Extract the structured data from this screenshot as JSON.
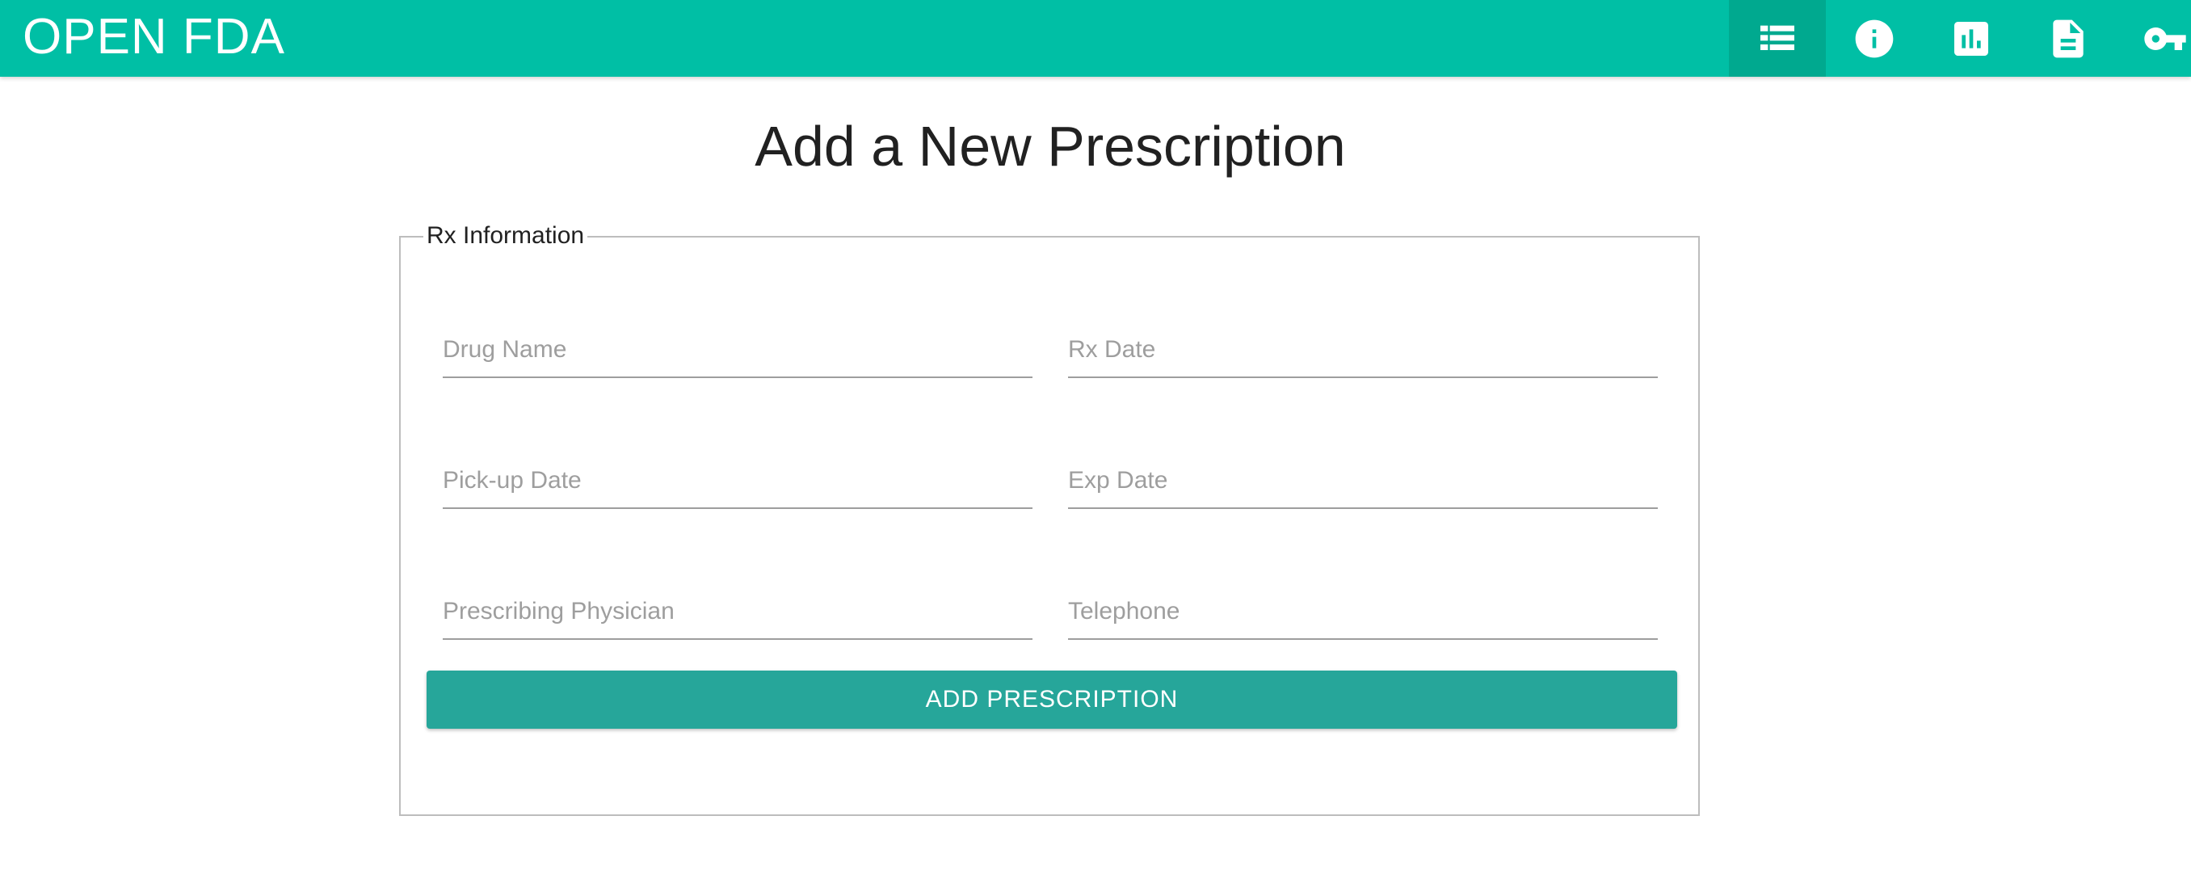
{
  "app": {
    "brand": "OPEN FDA"
  },
  "nav": {
    "icons": [
      {
        "name": "list-icon",
        "active": true
      },
      {
        "name": "info-icon",
        "active": false
      },
      {
        "name": "bar-chart-icon",
        "active": false
      },
      {
        "name": "document-icon",
        "active": false
      },
      {
        "name": "key-icon",
        "active": false
      }
    ],
    "accent_color": "#00bfa5",
    "active_color": "#00a98f"
  },
  "page": {
    "title": "Add a New Prescription"
  },
  "form": {
    "legend": "Rx Information",
    "fields": {
      "drug_name": {
        "placeholder": "Drug Name",
        "value": ""
      },
      "rx_date": {
        "placeholder": "Rx Date",
        "value": ""
      },
      "pickup_date": {
        "placeholder": "Pick-up Date",
        "value": ""
      },
      "exp_date": {
        "placeholder": "Exp Date",
        "value": ""
      },
      "prescribing_physician": {
        "placeholder": "Prescribing Physician",
        "value": ""
      },
      "telephone": {
        "placeholder": "Telephone",
        "value": ""
      }
    },
    "submit_label": "ADD PRESCRIPTION",
    "button_color": "#26a69a"
  }
}
